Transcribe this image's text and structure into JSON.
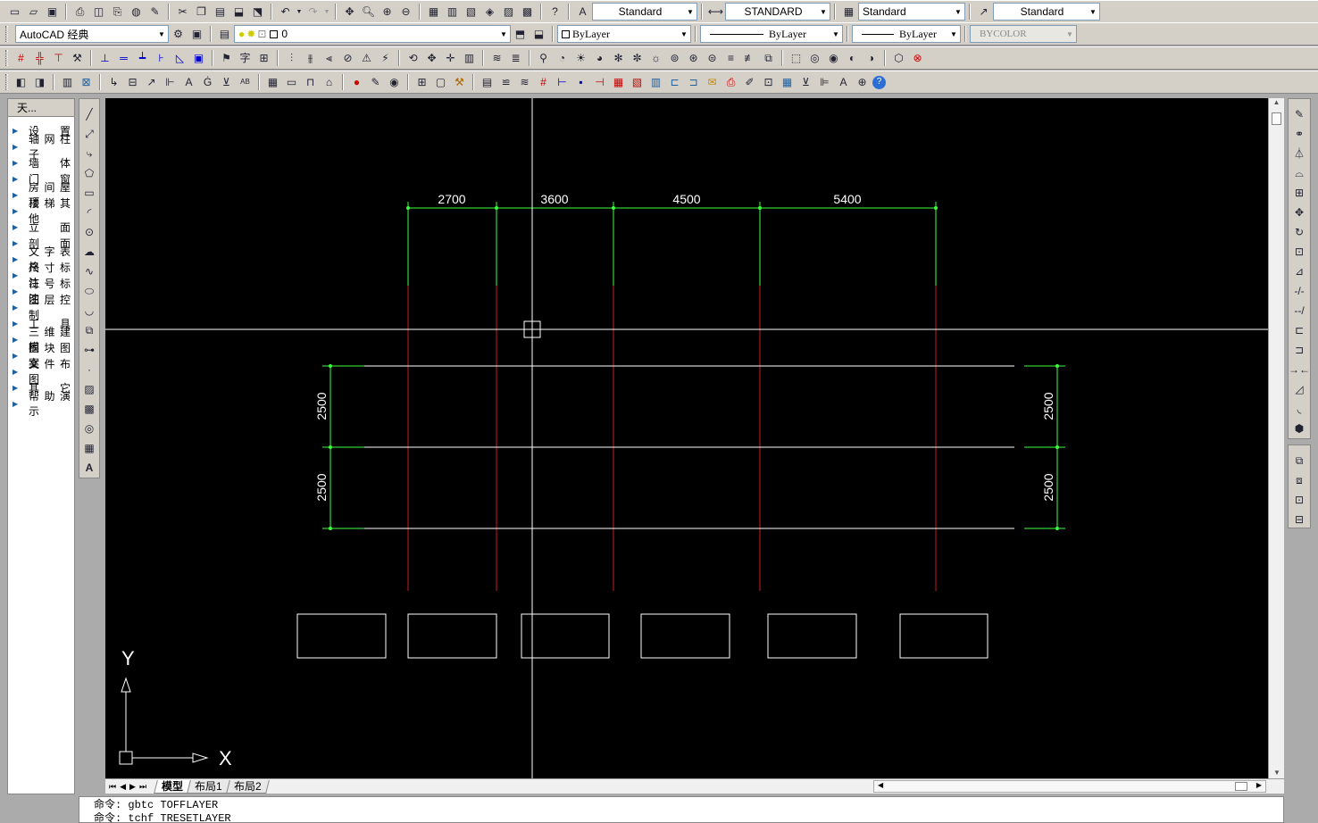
{
  "toolbar_standard": {
    "text_style": "Standard",
    "dim_style": "STANDARD",
    "table_style": "Standard",
    "mleader_style": "Standard"
  },
  "toolbar_layers": {
    "workspace": "AutoCAD 经典",
    "layer": "0",
    "color": "ByLayer",
    "linetype": "ByLayer",
    "lineweight": "ByLayer",
    "plotstyle": "BYCOLOR"
  },
  "tool_panel": {
    "title": "天...",
    "items": [
      "设　置",
      "轴网柱子",
      "墙　体",
      "门　窗",
      "房间屋顶",
      "楼梯其他",
      "立　面",
      "剖　面",
      "文字表格",
      "尺寸标注",
      "符号标注",
      "图层控制",
      "工　具",
      "三维建模",
      "图块图案",
      "文件布图",
      "其　它",
      "帮助演示"
    ]
  },
  "drawing": {
    "dims_top": [
      "2700",
      "3600",
      "4500",
      "5400"
    ],
    "dims_left": [
      "2500",
      "2500"
    ],
    "dims_right": [
      "2500",
      "2500"
    ],
    "ucs_x": "X",
    "ucs_y": "Y"
  },
  "tabs": [
    "模型",
    "布局1",
    "布局2"
  ],
  "command_lines": [
    "命令: gbtc TOFFLAYER",
    "命令: tchf TRESETLAYER"
  ],
  "colors": {
    "dim_green": "#3cff3c",
    "axis_red": "#c81e1e",
    "line_white": "#ffffff",
    "canvas_bg": "#000000"
  }
}
